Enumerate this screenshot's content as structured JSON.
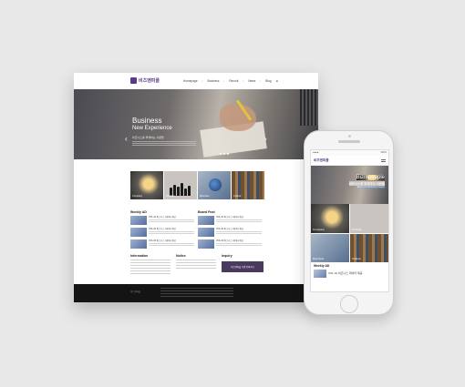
{
  "desktop": {
    "logo": "비즈앤피플",
    "nav": [
      "Homepage",
      "Business",
      "Recruit",
      "News",
      "Blog"
    ],
    "hero": {
      "title": "Business",
      "subtitle": "New Experience",
      "korean": "비즈니스를 위해하는 사람들"
    },
    "tiles": [
      {
        "label": "Company"
      },
      {
        "label": "Portfolio"
      },
      {
        "label": "Business"
      },
      {
        "label": "Culture"
      }
    ],
    "weekly_title": "Weekly AD",
    "board_title": "Board Post",
    "weekly_items": [
      "VOL.01 비즈니스 데이터 제공",
      "VOL.02 비즈니스 데이터 제공",
      "VOL.03 비즈니스 데이터 제공"
    ],
    "board_items": [
      "VOL.01 비즈니스 데이터 제공",
      "VOL.02 비즈니스 데이터 제공",
      "VOL.03 비즈니스 데이터 제공"
    ],
    "info_titles": [
      "Information",
      "Notice",
      "Inquiry"
    ],
    "button": "비즈앤피플 가맹 문의하기"
  },
  "phone": {
    "status_left": "●●●●",
    "status_right": "100%",
    "logo": "비즈앤피플",
    "hero": {
      "title": "Bizmpeople",
      "subtitle": "비즈니스를 위해하는 사람들",
      "small": "Business Marketing People"
    },
    "tiles": [
      {
        "label": "Company"
      },
      {
        "label": "Portfolio"
      },
      {
        "label": "Business"
      },
      {
        "label": "Culture"
      }
    ],
    "weekly_title": "Weekly AD",
    "weekly_item": "VOL.01 비즈니스 데이터 제공"
  }
}
